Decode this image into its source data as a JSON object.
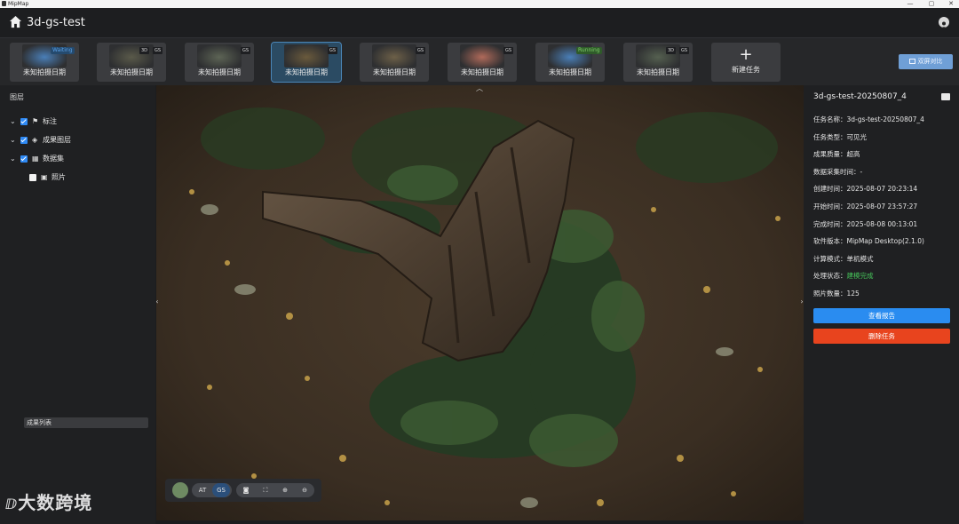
{
  "window": {
    "app_name": "MipMap",
    "min": "—",
    "restore": "▢",
    "close": "✕"
  },
  "header": {
    "title": "3d-gs-test"
  },
  "tasks": [
    {
      "label": "未知拍摄日期",
      "state": "Waiting",
      "badges": []
    },
    {
      "label": "未知拍摄日期",
      "state": "",
      "badges": [
        "3D",
        "GS"
      ]
    },
    {
      "label": "未知拍摄日期",
      "state": "",
      "badges": [
        "GS"
      ]
    },
    {
      "label": "未知拍摄日期",
      "state": "",
      "badges": [
        "GS"
      ],
      "active": true
    },
    {
      "label": "未知拍摄日期",
      "state": "",
      "badges": [
        "GS"
      ]
    },
    {
      "label": "未知拍摄日期",
      "state": "",
      "badges": [
        "GS"
      ]
    },
    {
      "label": "未知拍摄日期",
      "state": "Running",
      "badges": []
    },
    {
      "label": "未知拍摄日期",
      "state": "",
      "badges": [
        "3D",
        "GS"
      ]
    }
  ],
  "new_task": {
    "plus": "+",
    "label": "新建任务"
  },
  "compare_button": "双屏对比",
  "left_panel": {
    "title": "图层",
    "layers": [
      {
        "name": "标注",
        "checked": true,
        "expand": "⌄",
        "icon": "flag-icon"
      },
      {
        "name": "成果图层",
        "checked": true,
        "expand": "⌄",
        "icon": "shield-icon"
      },
      {
        "name": "数据集",
        "checked": true,
        "expand": "⌄",
        "icon": "dataset-icon"
      },
      {
        "name": "照片",
        "checked": false,
        "icon": "photo-icon"
      }
    ],
    "result_list": "成果列表",
    "watermark": "大数跨境"
  },
  "viewer": {
    "collapse_up": "︿",
    "left_arrow": "‹",
    "right_arrow": "›",
    "toolbar": {
      "at": "AT",
      "gs": "GS"
    }
  },
  "right_panel": {
    "title": "3d-gs-test-20250807_4",
    "info": [
      {
        "key": "任务名称：",
        "value": "3d-gs-test-20250807_4"
      },
      {
        "key": "任务类型：",
        "value": "可见光"
      },
      {
        "key": "成果质量：",
        "value": "超高"
      },
      {
        "key": "数据采集时间：",
        "value": "-"
      },
      {
        "key": "创建时间：",
        "value": "2025-08-07 20:23:14"
      },
      {
        "key": "开始时间：",
        "value": "2025-08-07 23:57:27"
      },
      {
        "key": "完成时间：",
        "value": "2025-08-08 00:13:01"
      },
      {
        "key": "软件版本：",
        "value": "MipMap Desktop(2.1.0)"
      },
      {
        "key": "计算模式：",
        "value": "单机模式"
      },
      {
        "key": "处理状态：",
        "value": "建模完成"
      },
      {
        "key": "照片数量：",
        "value": "125"
      }
    ],
    "report_button": "查看报告",
    "delete_button": "删除任务"
  },
  "colors": {
    "accent": "#2a8cf0",
    "danger": "#e8441e",
    "success": "#46c45a",
    "waiting": "#5aa0e6",
    "running": "#7fcf6a"
  }
}
